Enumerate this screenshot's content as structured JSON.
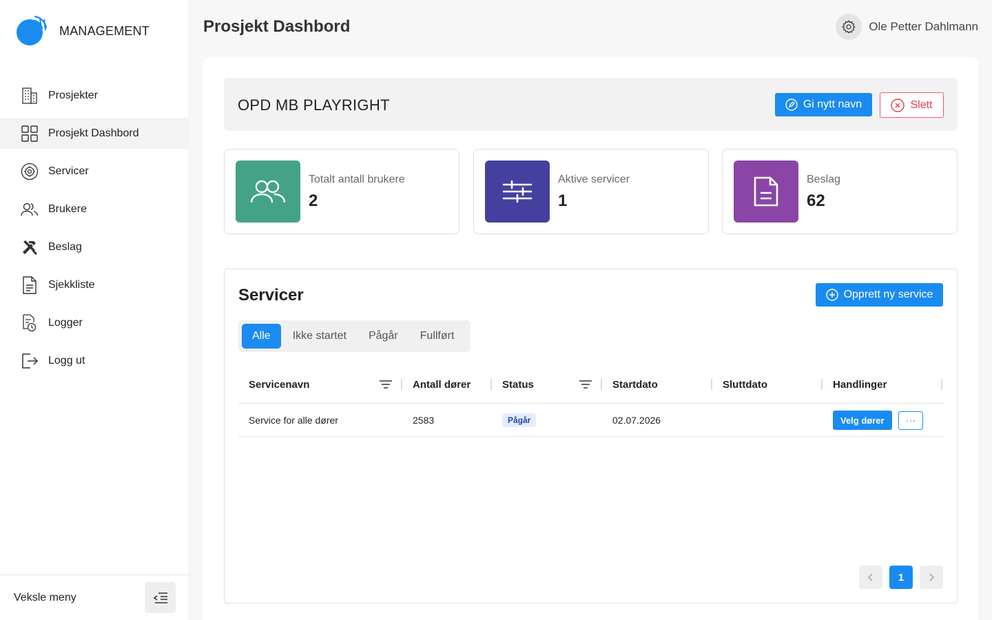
{
  "app": {
    "logo_text": "MANAGEMENT",
    "accent": "#1a8bf1"
  },
  "sidebar": {
    "items": [
      {
        "label": "Prosjekter",
        "icon": "building-icon"
      },
      {
        "label": "Prosjekt Dashbord",
        "icon": "grid-icon",
        "active": true
      },
      {
        "label": "Servicer",
        "icon": "service-gear-icon"
      },
      {
        "label": "Brukere",
        "icon": "users-icon"
      },
      {
        "label": "Beslag",
        "icon": "tools-icon"
      },
      {
        "label": "Sjekkliste",
        "icon": "document-icon"
      },
      {
        "label": "Logger",
        "icon": "log-clock-icon"
      },
      {
        "label": "Logg ut",
        "icon": "logout-icon"
      }
    ],
    "footer_label": "Veksle meny"
  },
  "header": {
    "title": "Prosjekt Dashbord",
    "user_name": "Ole Petter Dahlmann"
  },
  "project": {
    "name": "OPD MB PLAYRIGHT",
    "rename_label": "Gi nytt navn",
    "delete_label": "Slett"
  },
  "stats": [
    {
      "label": "Totalt antall brukere",
      "value": "2",
      "color": "#44a386",
      "icon": "users-icon"
    },
    {
      "label": "Aktive servicer",
      "value": "1",
      "color": "#4540a0",
      "icon": "sliders-icon"
    },
    {
      "label": "Beslag",
      "value": "62",
      "color": "#8a45a6",
      "icon": "document-icon"
    }
  ],
  "services": {
    "title": "Servicer",
    "create_label": "Opprett ny service",
    "filters": [
      "Alle",
      "Ikke startet",
      "Pågår",
      "Fullført"
    ],
    "active_filter": "Alle",
    "columns": [
      "Servicenavn",
      "Antall dører",
      "Status",
      "Startdato",
      "Sluttdato",
      "Handlinger"
    ],
    "rows": [
      {
        "name": "Service for alle dører",
        "doors": "2583",
        "status": "Pågår",
        "start": "02.07.2026",
        "end": "",
        "action_label": "Velg dører",
        "more_label": "···"
      }
    ],
    "pagination": {
      "current": "1"
    }
  }
}
